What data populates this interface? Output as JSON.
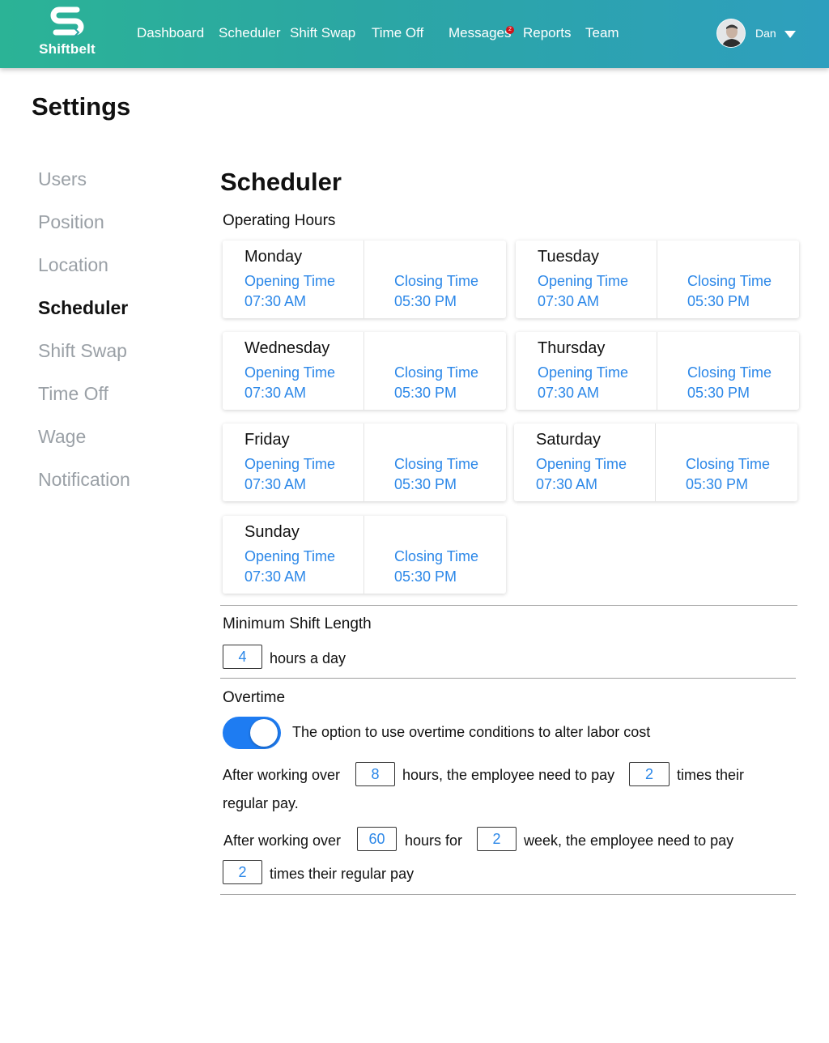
{
  "app": {
    "name": "Shiftbelt",
    "brand_gradient": [
      "#2bb396",
      "#2e9fbe"
    ],
    "accent_color": "#2b87e8"
  },
  "nav": {
    "items": [
      "Dashboard",
      "Scheduler",
      "Shift Swap",
      "Time Off",
      "Messages",
      "Reports",
      "Team"
    ],
    "messages_badge": "2",
    "user_name": "Dan"
  },
  "page": {
    "title": "Settings"
  },
  "sidebar": {
    "items": [
      "Users",
      "Position",
      "Location",
      "Scheduler",
      "Shift Swap",
      "Time Off",
      "Wage",
      "Notification"
    ],
    "active": "Scheduler"
  },
  "scheduler": {
    "title": "Scheduler",
    "operating_hours_label": "Operating Hours",
    "opening_label": "Opening Time",
    "closing_label": "Closing Time",
    "days": [
      {
        "day": "Monday",
        "open": "07:30 AM",
        "close": "05:30 PM"
      },
      {
        "day": "Tuesday",
        "open": "07:30 AM",
        "close": "05:30 PM"
      },
      {
        "day": "Wednesday",
        "open": "07:30 AM",
        "close": "05:30 PM"
      },
      {
        "day": "Thursday",
        "open": "07:30 AM",
        "close": "05:30 PM"
      },
      {
        "day": "Friday",
        "open": "07:30 AM",
        "close": "05:30 PM"
      },
      {
        "day": "Saturday",
        "open": "07:30 AM",
        "close": "05:30 PM"
      },
      {
        "day": "Sunday",
        "open": "07:30 AM",
        "close": "05:30 PM"
      }
    ],
    "min_shift": {
      "label": "Minimum Shift Length",
      "value": "4",
      "suffix": "hours a day"
    },
    "overtime": {
      "label": "Overtime",
      "toggle_on": true,
      "toggle_text": "The option to use overtime conditions to alter labor cost",
      "rule1": {
        "prefix": "After working over",
        "hours": "8",
        "middle": "hours, the employee need to pay",
        "multiplier": "2",
        "suffix_a": "times their",
        "suffix_b": "regular pay."
      },
      "rule2": {
        "prefix": "After working over",
        "hours": "60",
        "middle": "hours for",
        "weeks": "2",
        "after_weeks": "week, the employee need to pay",
        "multiplier": "2",
        "suffix": "times their regular pay"
      }
    }
  }
}
